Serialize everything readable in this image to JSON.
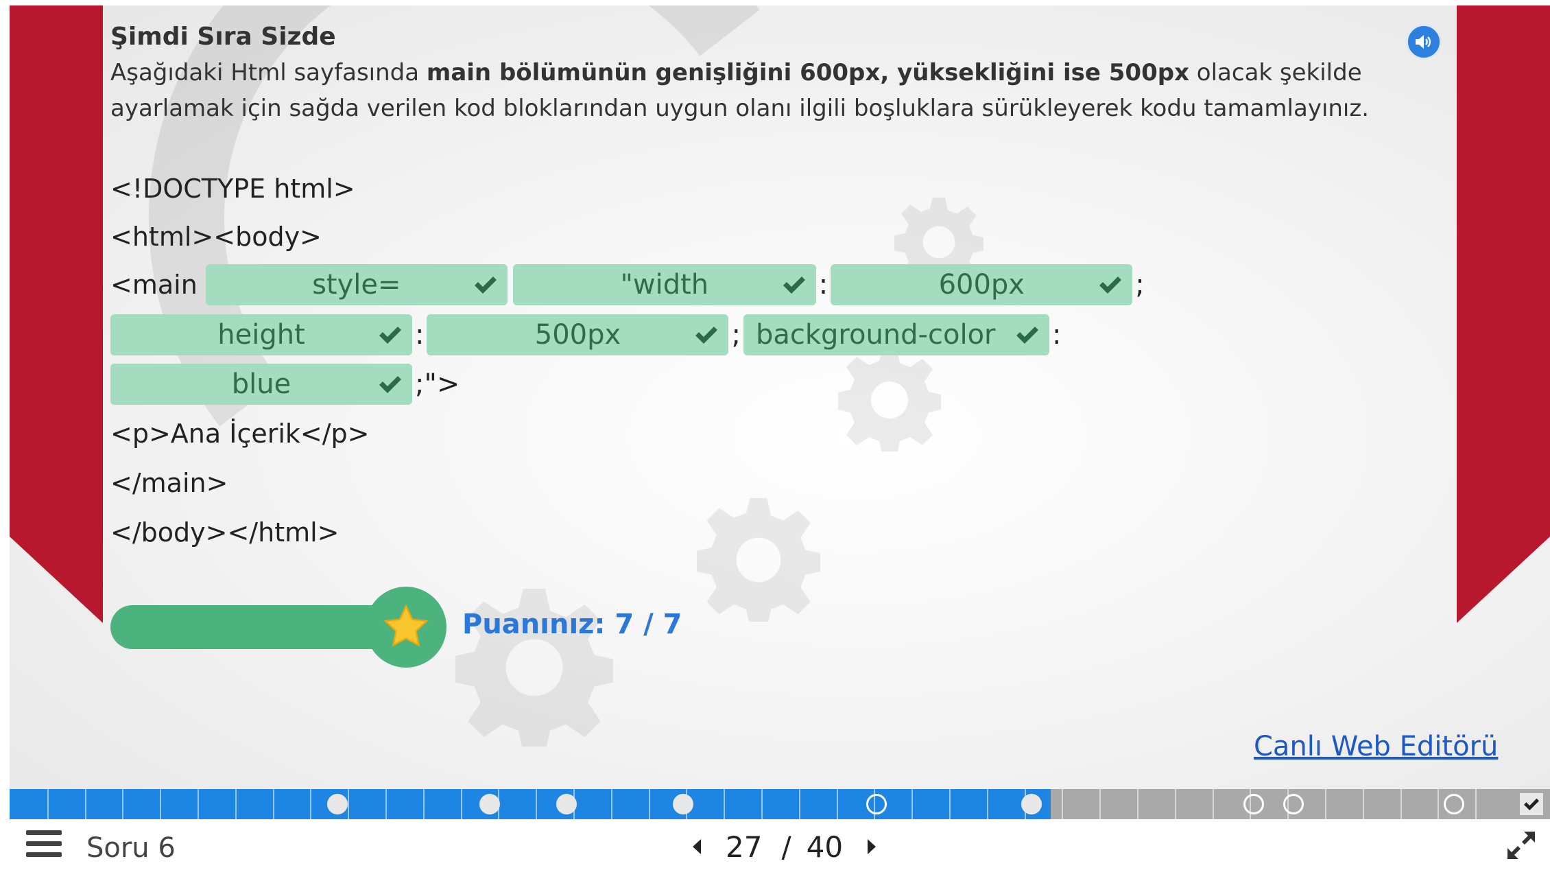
{
  "question": {
    "title": "Şimdi Sıra Sizde",
    "instruction_prefix": "Aşağıdaki Html sayfasında ",
    "instruction_bold": "main bölümünün genişliğini 600px, yüksekliğini ise 500px",
    "instruction_suffix": " olacak şekilde ayarlamak için sağda verilen kod bloklarından uygun olanı ilgili boşluklara sürükleyerek kodu tamamlayınız.",
    "audio_icon": "speaker-icon"
  },
  "code": {
    "line1": "<!DOCTYPE html>",
    "line2": "<html><body>",
    "main_open": "<main",
    "slot1": "style=",
    "slot2": "\"width",
    "colon1": ":",
    "slot3": "600px",
    "semi1": ";",
    "slot4": "height",
    "colon2": ":",
    "slot5": "500px",
    "semi2": ";",
    "slot6": "background-color",
    "colon3": ":",
    "slot7": "blue",
    "close_attr": ";\">",
    "line_p": "<p>Ana İçerik</p>",
    "line_main_close": "</main>",
    "line_end": "</body></html>"
  },
  "score": {
    "label": "Puanınız: 7 / 7",
    "progress": 1.0,
    "icon": "star-icon"
  },
  "link": {
    "label": "Canlı Web Editörü"
  },
  "timeline": {
    "total": 40,
    "current": 27
  },
  "footer": {
    "menu_icon": "hamburger-icon",
    "question_label": "Soru 6",
    "page_current": "27",
    "page_separator": "/",
    "page_total": "40",
    "fullscreen_icon": "expand-icon"
  },
  "colors": {
    "ribbon": "#b8182e",
    "slot_bg": "#a3dcbe",
    "slot_text": "#2f6c4c",
    "check": "#2b6b4a",
    "progress": "#4cb37e",
    "score_text": "#2b78d8",
    "link": "#1d58c8",
    "timeline_done": "#1e86e2",
    "timeline_rest": "#a9a9a9"
  }
}
